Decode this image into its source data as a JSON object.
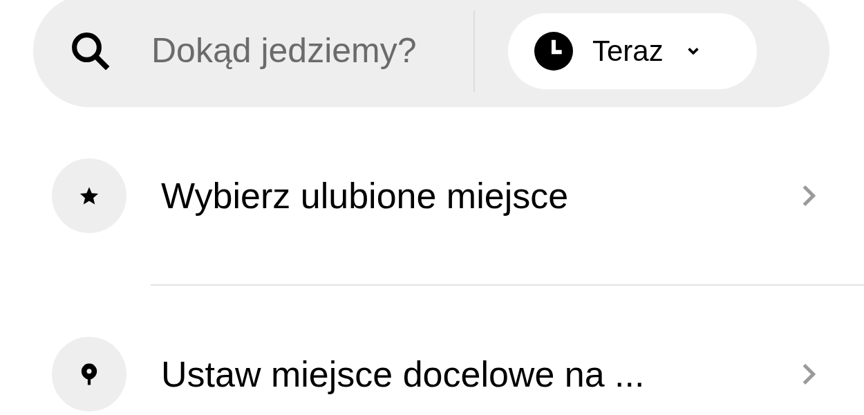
{
  "search": {
    "placeholder": "Dokąd jedziemy?"
  },
  "time_picker": {
    "label": "Teraz"
  },
  "items": [
    {
      "kind": "favorite",
      "label": "Wybierz ulubione miejsce"
    },
    {
      "kind": "destination",
      "label": "Ustaw miejsce docelowe na ..."
    }
  ]
}
